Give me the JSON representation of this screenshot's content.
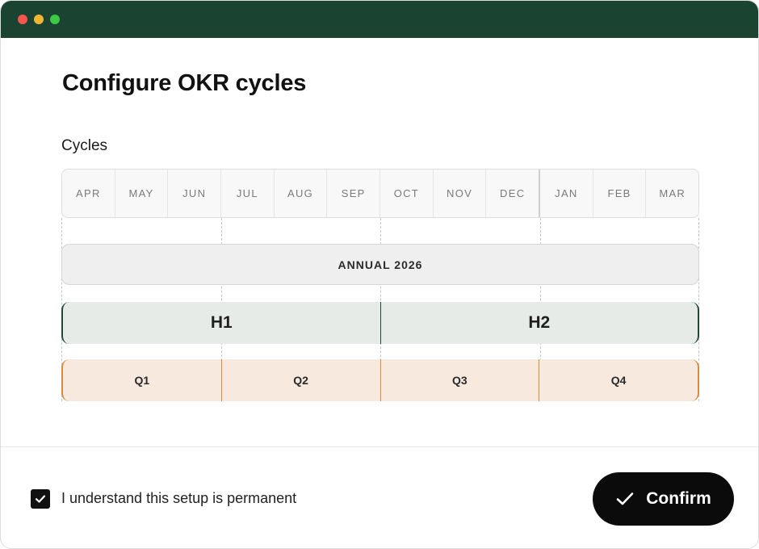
{
  "window": {
    "controls": [
      "close",
      "minimize",
      "maximize"
    ],
    "titlebar_color": "#1b4332"
  },
  "dialog": {
    "title": "Configure OKR cycles",
    "section_label": "Cycles"
  },
  "timeline": {
    "months": [
      "APR",
      "MAY",
      "JUN",
      "JUL",
      "AUG",
      "SEP",
      "OCT",
      "NOV",
      "DEC",
      "JAN",
      "FEB",
      "MAR"
    ],
    "annual": {
      "label": "ANNUAL 2026",
      "color": "#efefef"
    },
    "halves": [
      {
        "label": "H1",
        "color": "#e7ebe8"
      },
      {
        "label": "H2",
        "color": "#e7ebe8"
      }
    ],
    "quarters": [
      {
        "label": "Q1",
        "color": "#f8e9de"
      },
      {
        "label": "Q2",
        "color": "#f8e9de"
      },
      {
        "label": "Q3",
        "color": "#f8e9de"
      },
      {
        "label": "Q4",
        "color": "#f8e9de"
      }
    ],
    "half_accent": "#1f4a36",
    "quarter_accent": "#d98a3b"
  },
  "footer": {
    "acknowledge_checked": true,
    "acknowledge_label": "I understand this setup is permanent",
    "confirm_label": "Confirm",
    "confirm_icon": "check-icon"
  }
}
